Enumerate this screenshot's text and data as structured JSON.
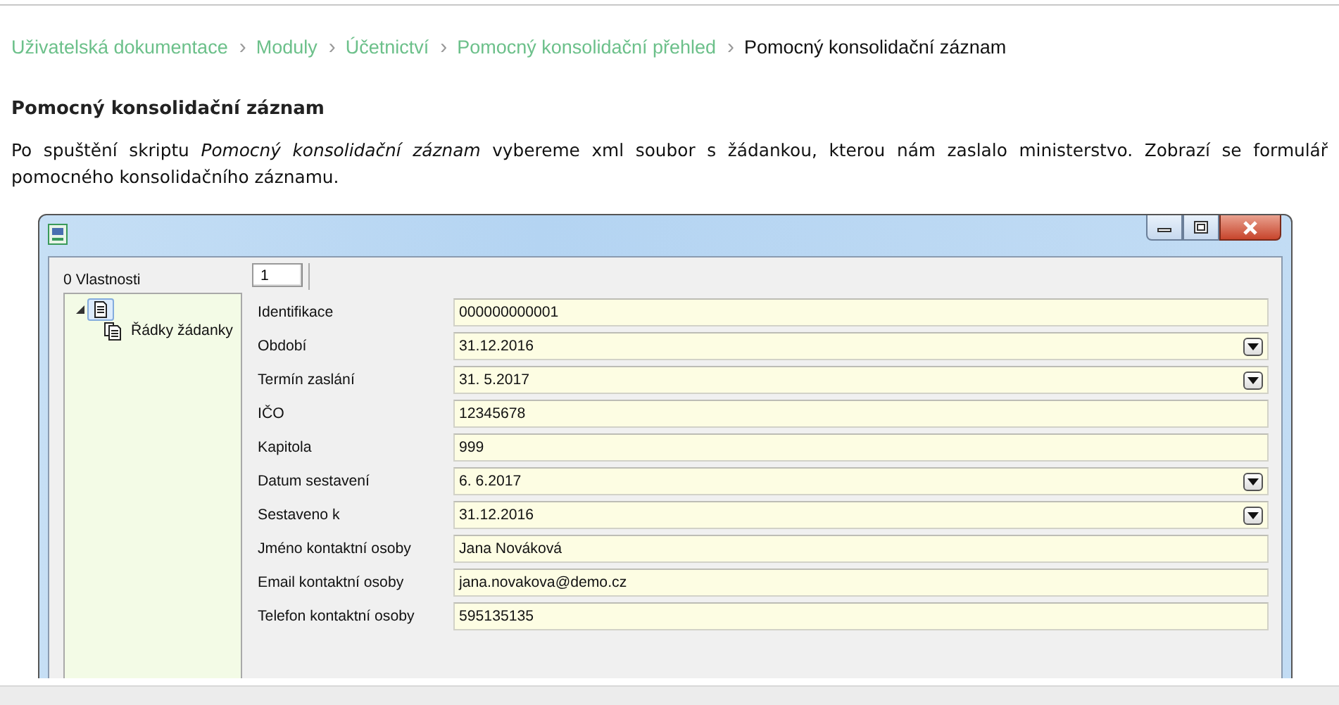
{
  "breadcrumb": [
    {
      "kind": "link",
      "text": "Uživatelská dokumentace"
    },
    {
      "kind": "separator",
      "text": "›"
    },
    {
      "kind": "link",
      "text": "Moduly"
    },
    {
      "kind": "separator",
      "text": "›"
    },
    {
      "kind": "link",
      "text": "Účetnictví"
    },
    {
      "kind": "separator",
      "text": "›"
    },
    {
      "kind": "link",
      "text": "Pomocný konsolidační přehled"
    },
    {
      "kind": "separator",
      "text": "›"
    },
    {
      "kind": "current",
      "text": "Pomocný konsolidační záznam"
    }
  ],
  "article": {
    "heading": "Pomocný konsolidační záznam",
    "paragraph": "Po spuštění skriptu *Pomocný konsolidační záznam* vybereme xml soubor s žádankou, kterou nám zaslalo ministerstvo. Zobrazí se formulář pomocného konsolidačního záznamu."
  },
  "window": {
    "panel_label": "0 Vlastnosti",
    "tree": [
      {
        "selected": true,
        "expanded": true,
        "children": [
          {
            "label": "Řádky žádanky",
            "selected": false
          }
        ]
      }
    ],
    "tabs": [
      {
        "label": "1",
        "selected": true
      }
    ],
    "fields": [
      {
        "label": "Identifikace",
        "value": "000000000001",
        "kind": "text"
      },
      {
        "label": "Období",
        "value": "31.12.2016",
        "kind": "dropdown"
      },
      {
        "label": "Termín zaslání",
        "value": "31. 5.2017",
        "kind": "dropdown"
      },
      {
        "label": "IČO",
        "value": "12345678",
        "kind": "text"
      },
      {
        "label": "Kapitola",
        "value": "999",
        "kind": "text"
      },
      {
        "label": "Datum sestavení",
        "value": "6. 6.2017",
        "kind": "dropdown"
      },
      {
        "label": "Sestaveno k",
        "value": "31.12.2016",
        "kind": "dropdown"
      },
      {
        "label": "Jméno kontaktní osoby",
        "value": "Jana Nováková",
        "kind": "text"
      },
      {
        "label": "Email kontaktní osoby",
        "value": "jana.novakova@demo.cz",
        "kind": "text"
      },
      {
        "label": "Telefon kontaktní osoby",
        "value": "595135135",
        "kind": "text"
      }
    ]
  }
}
